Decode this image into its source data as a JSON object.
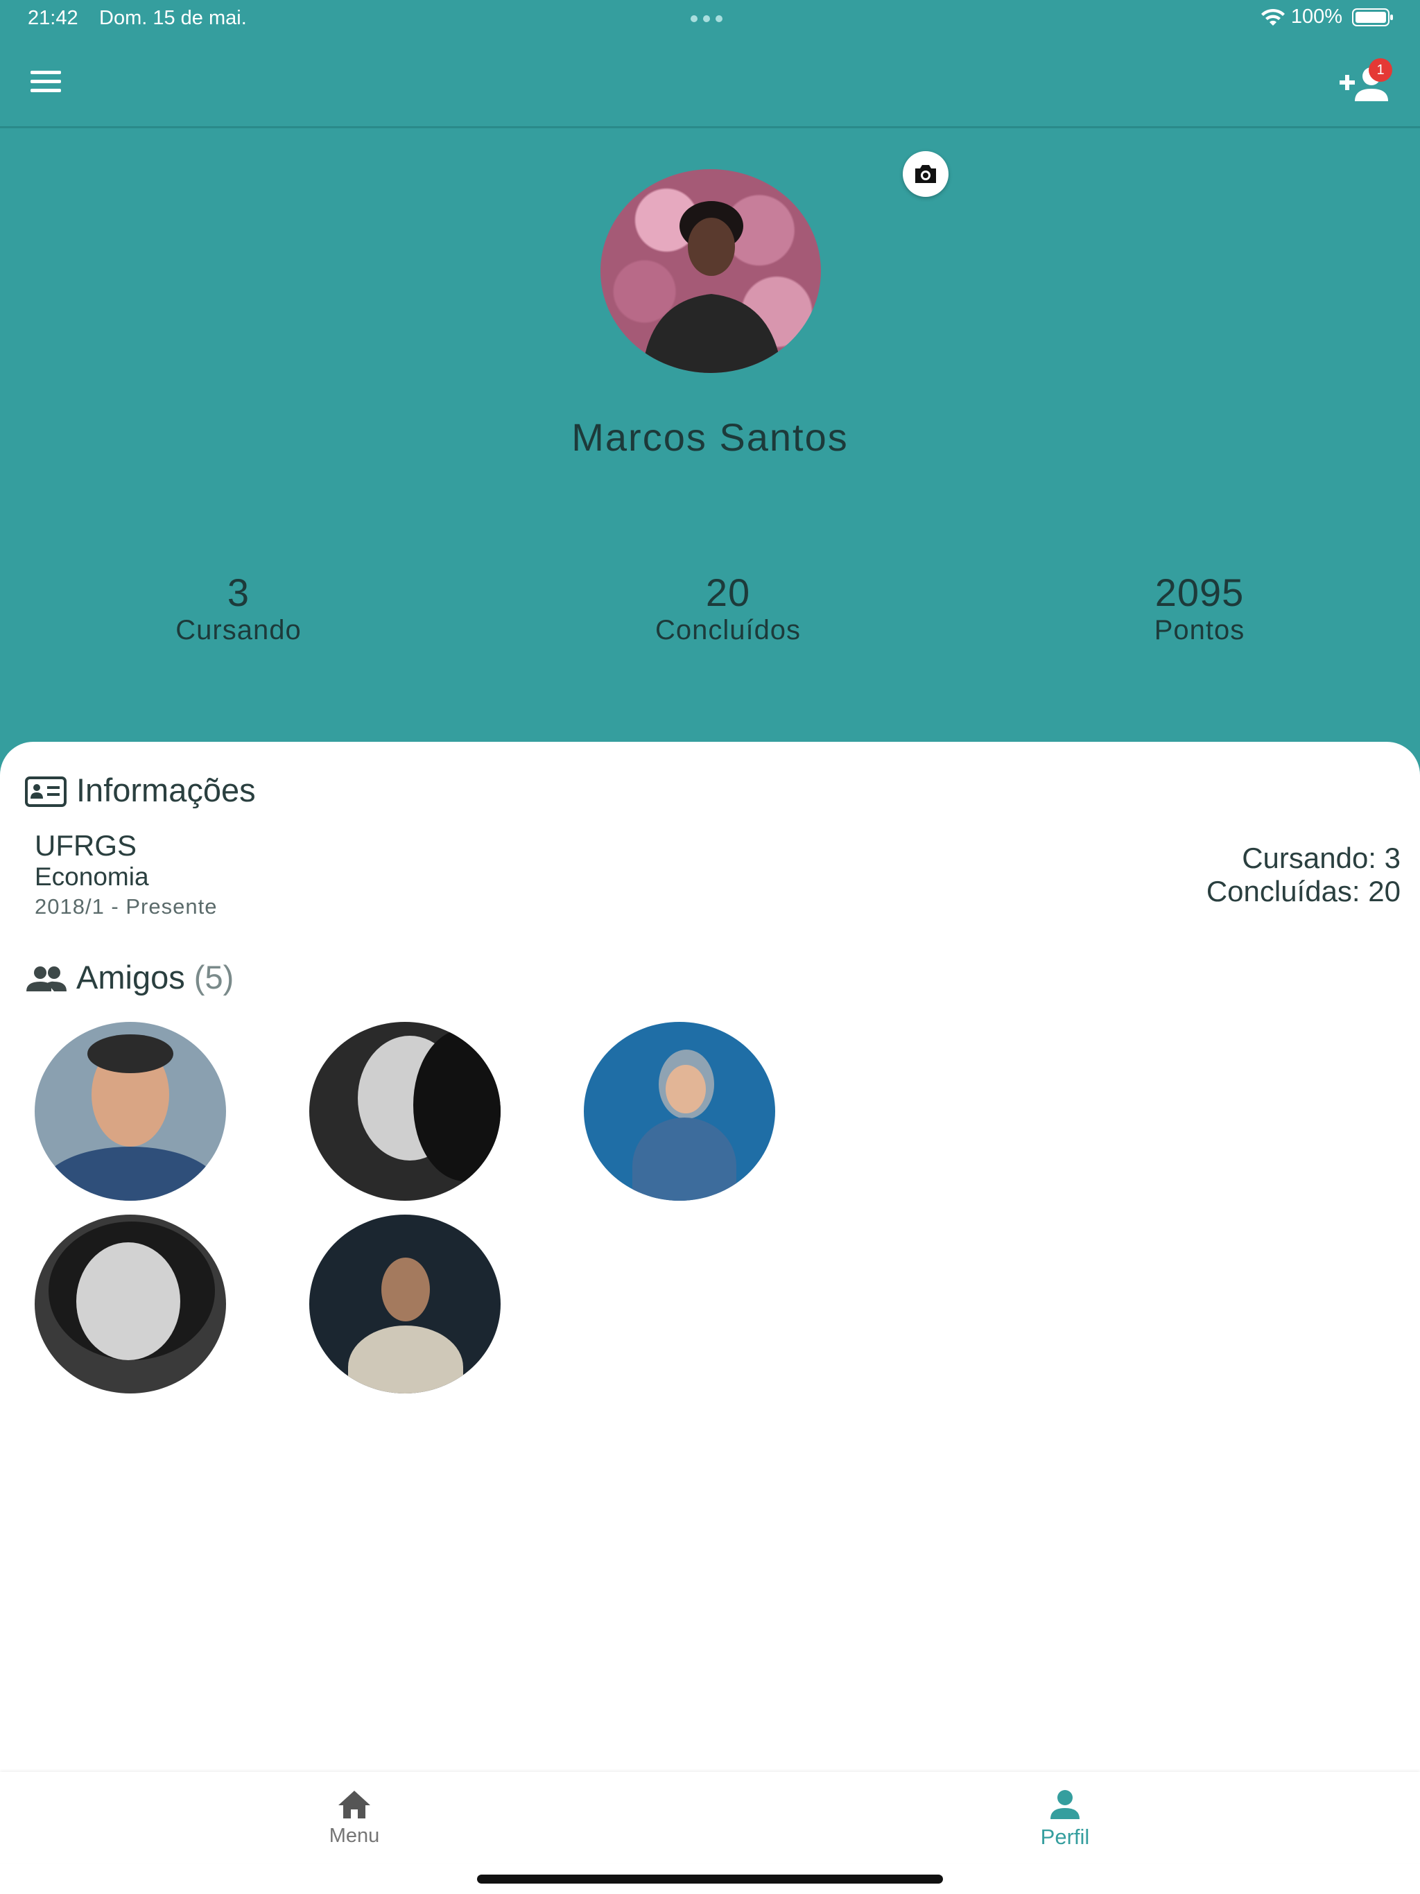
{
  "status_bar": {
    "time": "21:42",
    "date": "Dom. 15 de mai.",
    "battery": "100%"
  },
  "app_bar": {
    "menu_icon": "hamburger-menu-icon",
    "add_friend_icon": "add-person-icon",
    "notification_count": "1"
  },
  "profile": {
    "name": "Marcos Santos",
    "camera_icon": "camera-icon"
  },
  "stats": [
    {
      "value": "3",
      "label": "Cursando"
    },
    {
      "value": "20",
      "label": "Concluídos"
    },
    {
      "value": "2095",
      "label": "Pontos"
    }
  ],
  "info": {
    "title": "Informações",
    "icon": "id-card-icon",
    "university": "UFRGS",
    "course": "Economia",
    "period": "2018/1 - Presente",
    "cursando": "Cursando: 3",
    "concluidas": "Concluídas: 20"
  },
  "friends": {
    "title": "Amigos",
    "count": "(5)",
    "icon": "people-icon",
    "items": [
      {
        "avatar": "friend-avatar-1"
      },
      {
        "avatar": "friend-avatar-2"
      },
      {
        "avatar": "friend-avatar-3"
      },
      {
        "avatar": "friend-avatar-4"
      },
      {
        "avatar": "friend-avatar-5"
      }
    ]
  },
  "bottom_nav": {
    "items": [
      {
        "label": "Menu",
        "icon": "home-icon"
      },
      {
        "label": "Perfil",
        "icon": "person-icon"
      }
    ]
  },
  "colors": {
    "primary": "#359e9e",
    "text_dark": "#1d3a3a",
    "badge": "#e53935"
  }
}
